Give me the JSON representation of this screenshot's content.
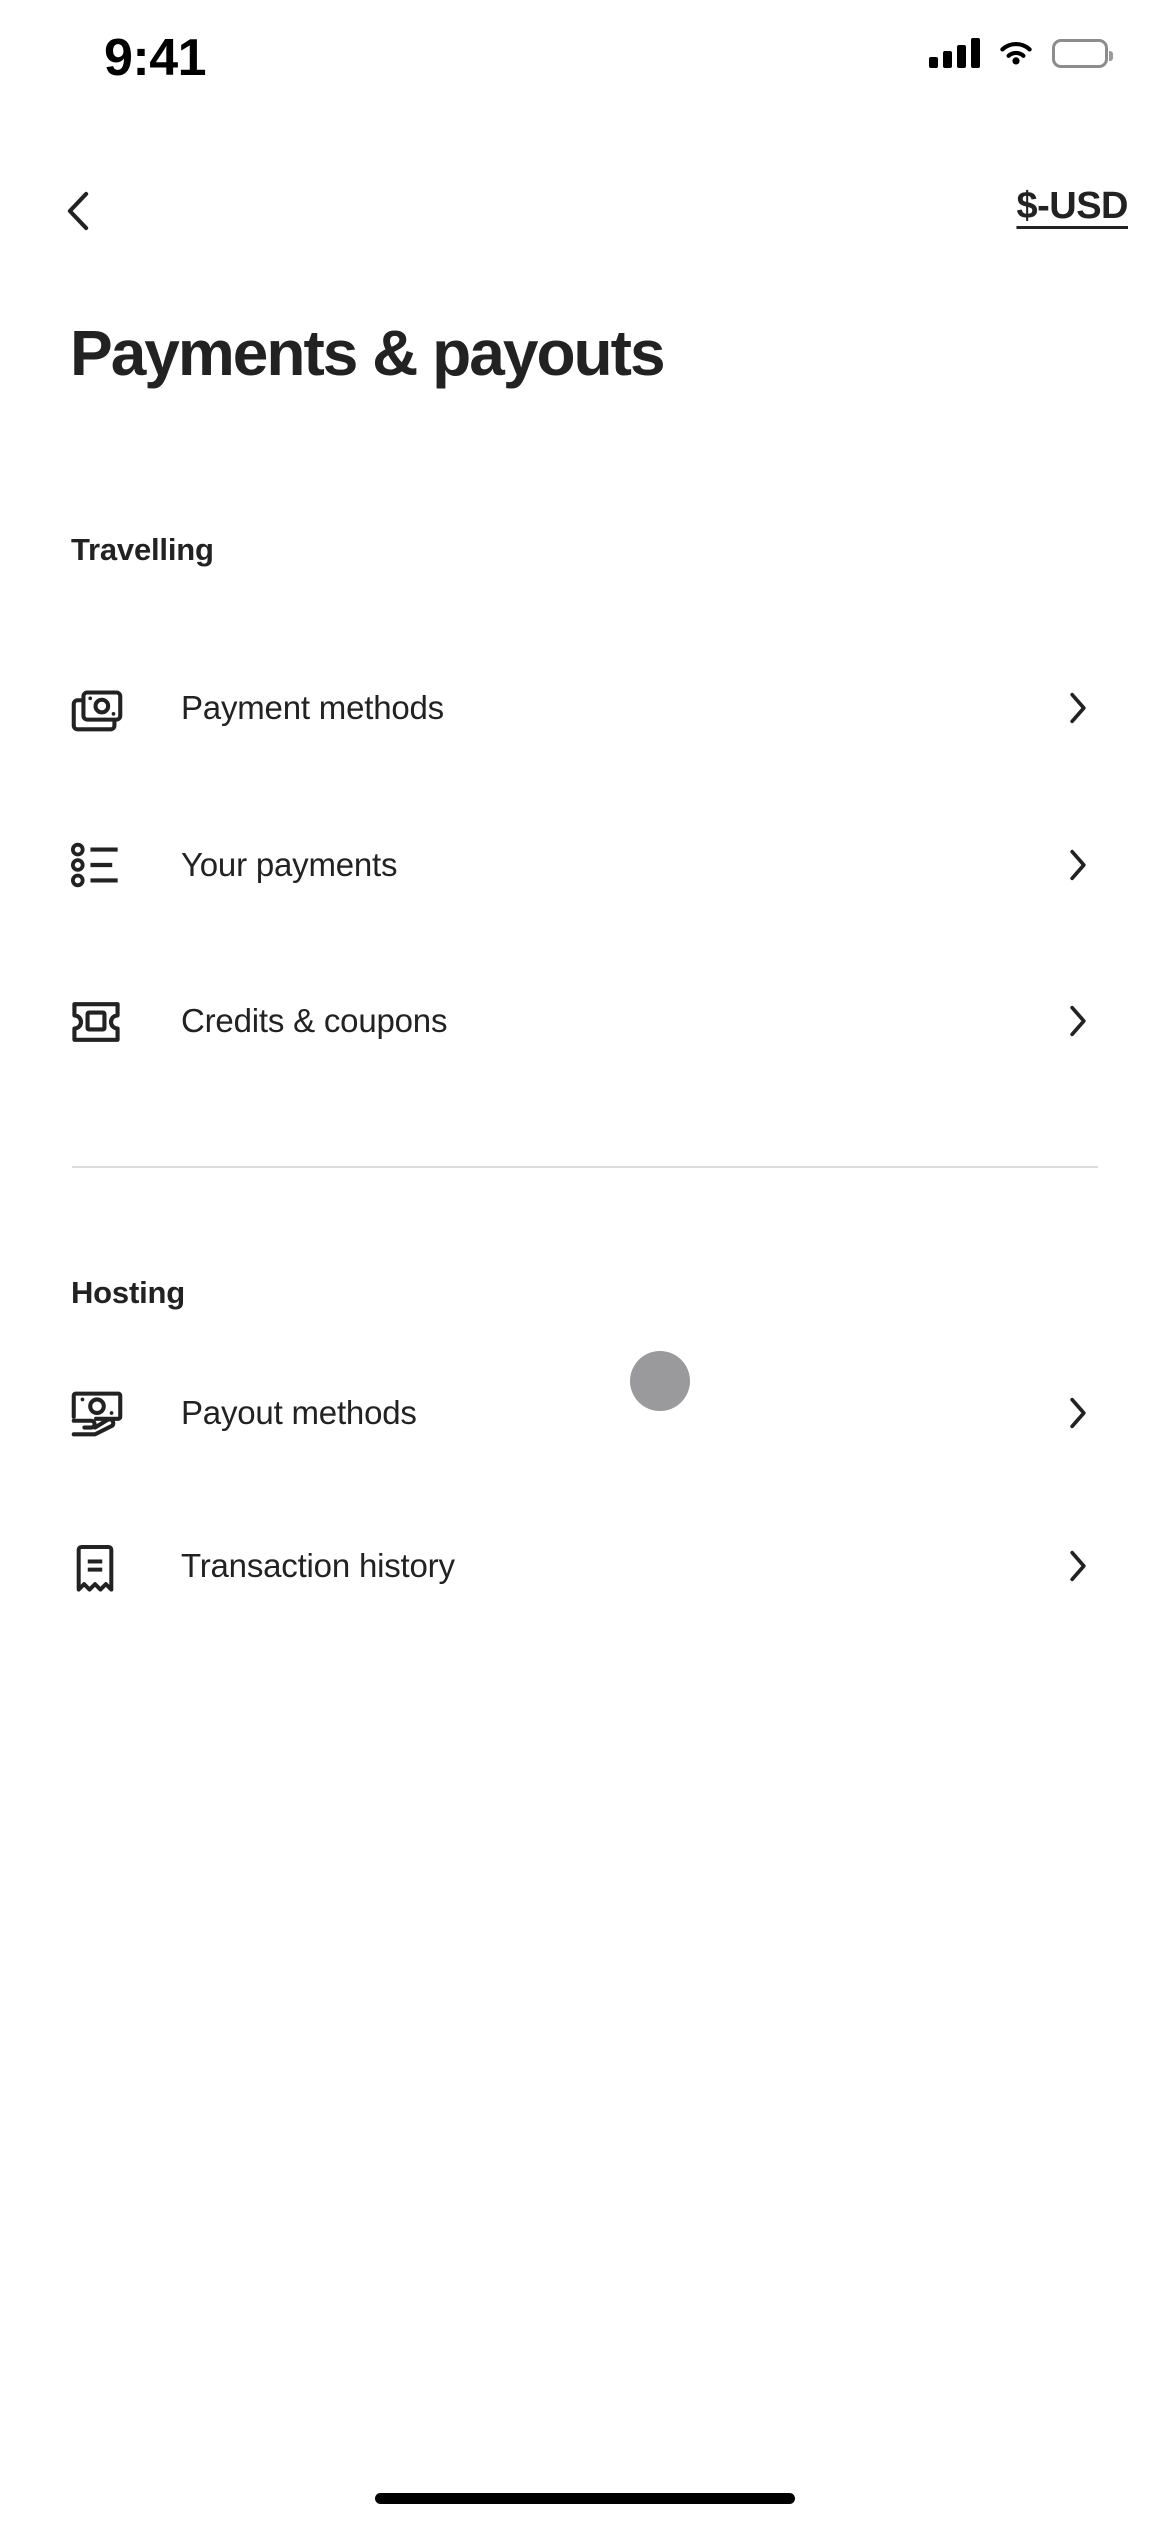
{
  "status_bar": {
    "time": "9:41",
    "cellular_icon": "cellular-signal-icon",
    "wifi_icon": "wifi-icon",
    "battery_icon": "battery-full-icon"
  },
  "top_nav": {
    "back_icon": "chevron-left-icon",
    "currency_label": "$-USD"
  },
  "header": {
    "title": "Payments & payouts"
  },
  "sections": [
    {
      "id": "travelling",
      "title": "Travelling",
      "items": [
        {
          "label": "Payment methods",
          "icon": "banknotes-icon",
          "chevron": "chevron-right-icon"
        },
        {
          "label": "Your payments",
          "icon": "list-bullet-icon",
          "chevron": "chevron-right-icon"
        },
        {
          "label": "Credits & coupons",
          "icon": "ticket-icon",
          "chevron": "chevron-right-icon"
        }
      ]
    },
    {
      "id": "hosting",
      "title": "Hosting",
      "items": [
        {
          "label": "Payout methods",
          "icon": "hand-holding-money-icon",
          "chevron": "chevron-right-icon"
        },
        {
          "label": "Transaction history",
          "icon": "receipt-icon",
          "chevron": "chevron-right-icon"
        }
      ]
    }
  ],
  "overlay": {
    "touch_indicator": "touch-point-indicator",
    "touch_color": "#9a9a9d"
  },
  "home_indicator": "home-indicator",
  "colors": {
    "text_primary": "#222222",
    "divider": "#dddddd",
    "background": "#ffffff"
  }
}
